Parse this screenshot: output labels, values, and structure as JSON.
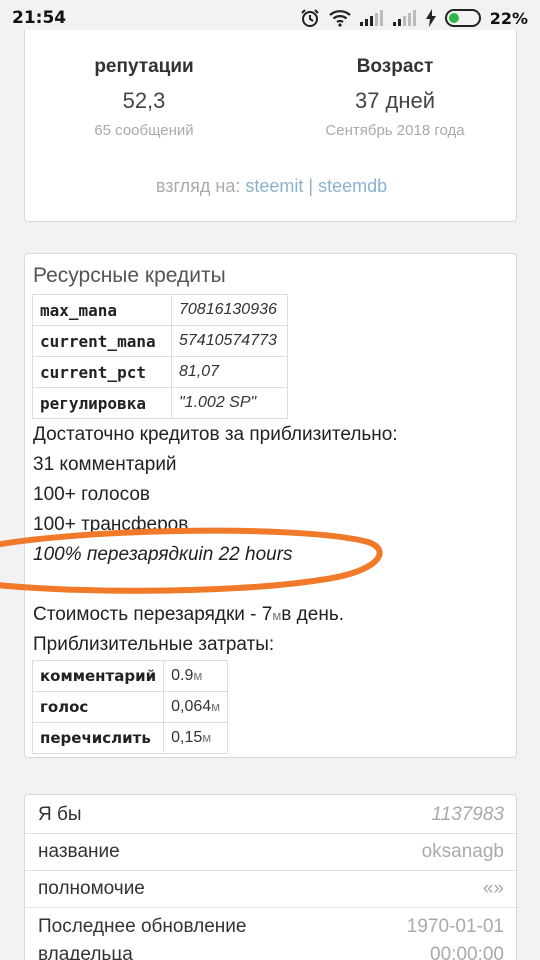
{
  "status_bar": {
    "time": "21:54",
    "battery": "22%"
  },
  "profile_stats": {
    "reputation": {
      "label": "репутации",
      "value": "52,3",
      "sub": "65 сообщений"
    },
    "age": {
      "label": "Возраст",
      "value": "37 дней",
      "sub": "Сентябрь 2018 года"
    },
    "view_on": {
      "prefix": "взгляд на: ",
      "link1": "steemit",
      "separator": "|",
      "link2": "steemdb"
    }
  },
  "resource_credits": {
    "title": "Ресурсные кредиты",
    "rows": [
      {
        "key": "max_mana",
        "value": "70816130936"
      },
      {
        "key": "current_mana",
        "value": "57410574773"
      },
      {
        "key": "current_pct",
        "value": "81,07"
      },
      {
        "key": "регулировка",
        "value": "\"1.002 SP\""
      }
    ],
    "enough_for": "Достаточно кредитов за приблизительно:",
    "comments": "31 комментарий",
    "votes": "100+ голосов",
    "transfers": "100+ трансферов",
    "recharge": "100% перезарядкиin 22 hours",
    "recharge_cost_text": "Стоимость перезарядки - 7",
    "recharge_cost_unit": "м",
    "recharge_cost_suffix": "в день.",
    "approx_costs": "Приблизительные затраты:",
    "cost_rows": [
      {
        "key": "комментарий",
        "value": "0.9",
        "unit": "м"
      },
      {
        "key": "голос",
        "value": "0,064",
        "unit": "м"
      },
      {
        "key": "перечислить",
        "value": "0,15",
        "unit": "м"
      }
    ],
    "highlight_color": "#f07a2a"
  },
  "account_info": {
    "rows": [
      {
        "key": "Я бы",
        "value": "1137983"
      },
      {
        "key": "название",
        "value": "oksanagb"
      },
      {
        "key": "полномочие",
        "value": "«»"
      },
      {
        "key": "Последнее обновление владельца",
        "value": "1970-01-01 00:00:00"
      }
    ]
  }
}
